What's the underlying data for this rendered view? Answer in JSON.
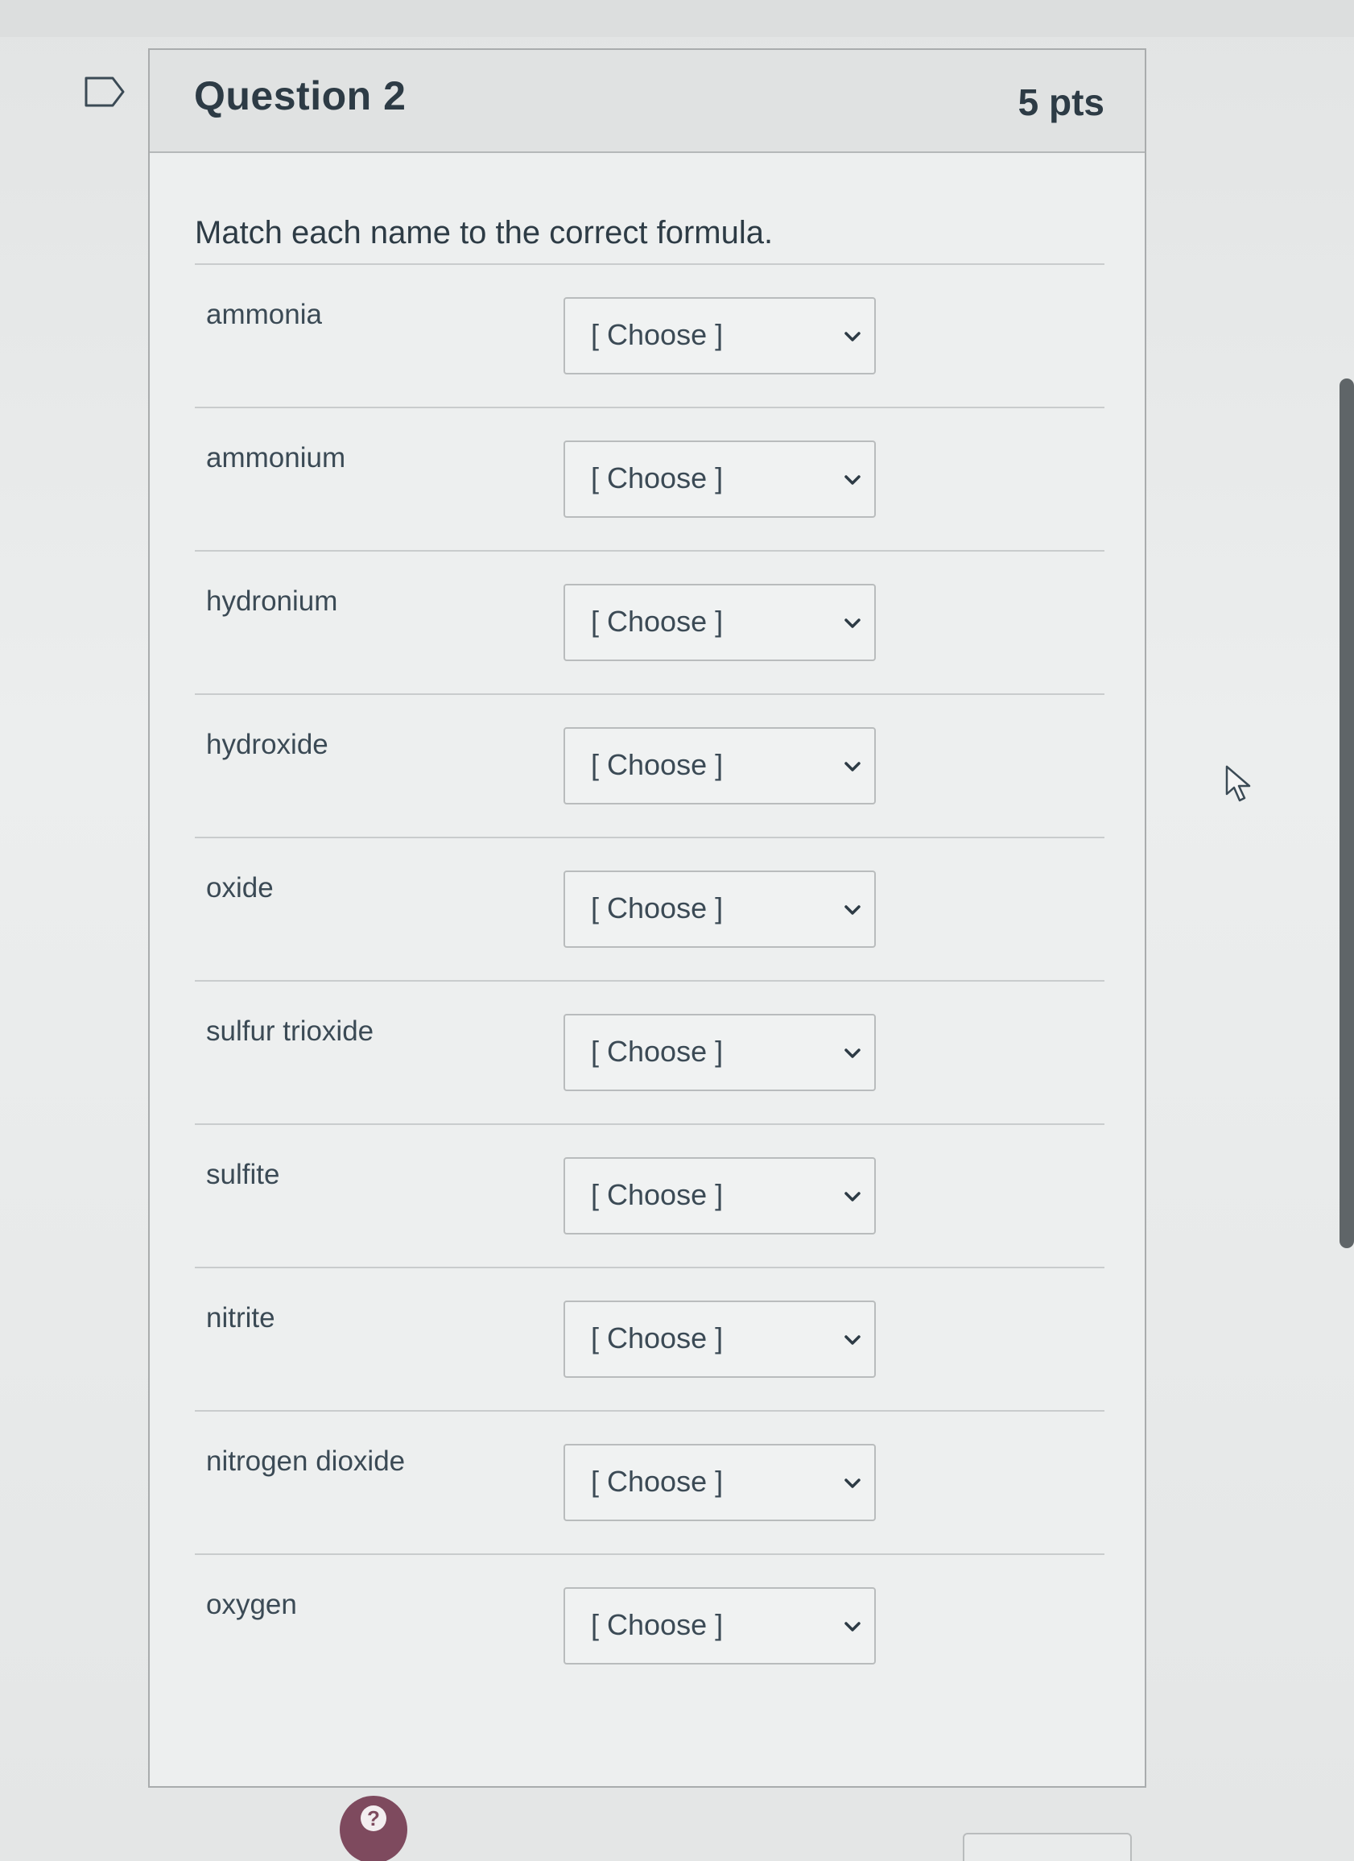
{
  "question": {
    "title": "Question 2",
    "points": "5 pts",
    "prompt": "Match each name to the correct formula."
  },
  "placeholder": "[ Choose ]",
  "matches": [
    {
      "label": "ammonia",
      "selected": "[ Choose ]"
    },
    {
      "label": "ammonium",
      "selected": "[ Choose ]"
    },
    {
      "label": "hydronium",
      "selected": "[ Choose ]"
    },
    {
      "label": "hydroxide",
      "selected": "[ Choose ]"
    },
    {
      "label": "oxide",
      "selected": "[ Choose ]"
    },
    {
      "label": "sulfur trioxide",
      "selected": "[ Choose ]"
    },
    {
      "label": "sulfite",
      "selected": "[ Choose ]"
    },
    {
      "label": "nitrite",
      "selected": "[ Choose ]"
    },
    {
      "label": "nitrogen dioxide",
      "selected": "[ Choose ]"
    },
    {
      "label": "oxygen",
      "selected": "[ Choose ]"
    }
  ],
  "help": {
    "glyph": "?"
  },
  "icons": {
    "flag": "bookmark-flag-icon",
    "chevron": "chevron-down-icon",
    "cursor": "mouse-pointer-icon",
    "help": "help-circle-icon"
  },
  "colors": {
    "text": "#2d3b45",
    "help_button": "#7e4a5e",
    "border": "#b9bcbd"
  }
}
